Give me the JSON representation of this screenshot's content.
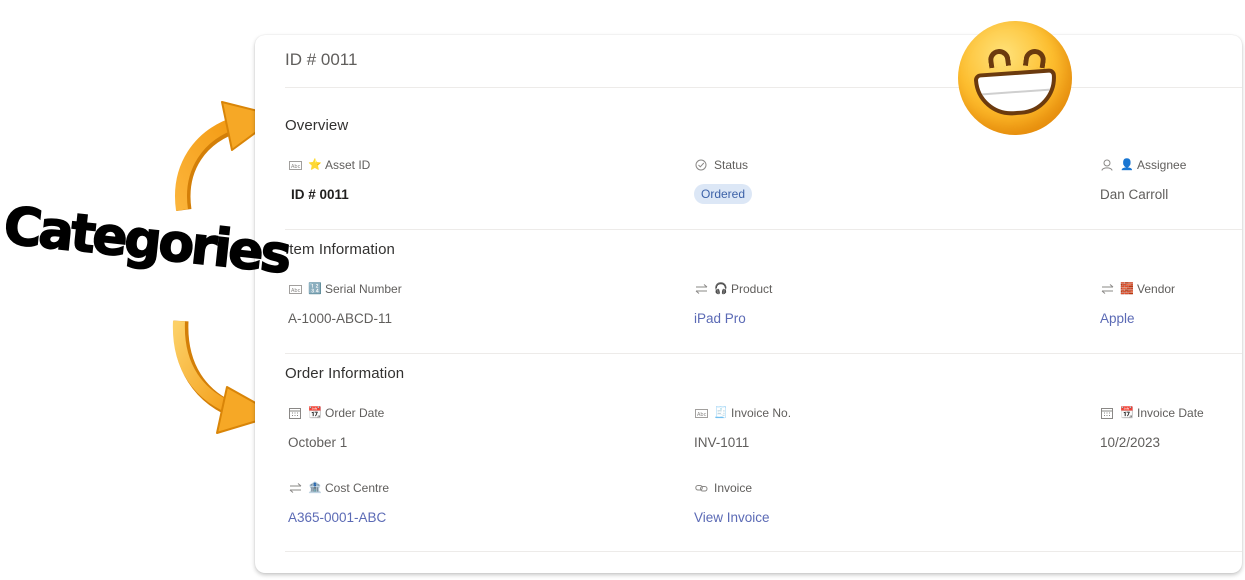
{
  "card": {
    "title": "ID # 0011"
  },
  "sections": [
    {
      "title": "Overview",
      "fields": [
        {
          "type_icon": "text-field-icon",
          "emoji": "⭐",
          "emoji_name": "star-icon",
          "label": "Asset ID",
          "value": "ID # 0011",
          "style": "bold"
        },
        {
          "type_icon": "choice-check-icon",
          "emoji": "",
          "emoji_name": "",
          "label": "Status",
          "value": "Ordered",
          "style": "pill"
        },
        {
          "type_icon": "person-icon",
          "emoji": "👤",
          "emoji_name": "user-silhouette-icon",
          "label": "Assignee",
          "value": "Dan Carroll",
          "style": "plain"
        }
      ]
    },
    {
      "title": "Item Information",
      "fields": [
        {
          "type_icon": "text-field-icon",
          "emoji": "🔢",
          "emoji_name": "numbers-icon",
          "label": "Serial Number",
          "value": "A-1000-ABCD-11",
          "style": "plain"
        },
        {
          "type_icon": "lookup-icon",
          "emoji": "🎧",
          "emoji_name": "headphones-icon",
          "label": "Product",
          "value": "iPad Pro",
          "style": "link"
        },
        {
          "type_icon": "lookup-icon",
          "emoji": "🧱",
          "emoji_name": "bricks-icon",
          "label": "Vendor",
          "value": "Apple",
          "style": "link"
        }
      ]
    },
    {
      "title": "Order Information",
      "fields": [
        {
          "type_icon": "calendar-icon",
          "emoji": "📆",
          "emoji_name": "calendar-emoji-icon",
          "label": "Order Date",
          "value": "October 1",
          "style": "plain"
        },
        {
          "type_icon": "text-field-icon",
          "emoji": "🧾",
          "emoji_name": "receipt-icon",
          "label": "Invoice No.",
          "value": "INV-1011",
          "style": "plain"
        },
        {
          "type_icon": "calendar-icon",
          "emoji": "📆",
          "emoji_name": "calendar-emoji-icon",
          "label": "Invoice Date",
          "value": "10/2/2023",
          "style": "plain"
        },
        {
          "type_icon": "lookup-icon",
          "emoji": "🏦",
          "emoji_name": "bank-icon",
          "label": "Cost Centre",
          "value": "A365-0001-ABC",
          "style": "link"
        },
        {
          "type_icon": "link-icon",
          "emoji": "",
          "emoji_name": "",
          "label": "Invoice",
          "value": "View Invoice",
          "style": "link"
        }
      ]
    }
  ],
  "annotation": {
    "label": "Categories",
    "arrow_color": "#f5a623"
  },
  "colors": {
    "link": "#5b6ab5",
    "pill_bg": "#dce7f6",
    "pill_text": "#3d62a8"
  }
}
